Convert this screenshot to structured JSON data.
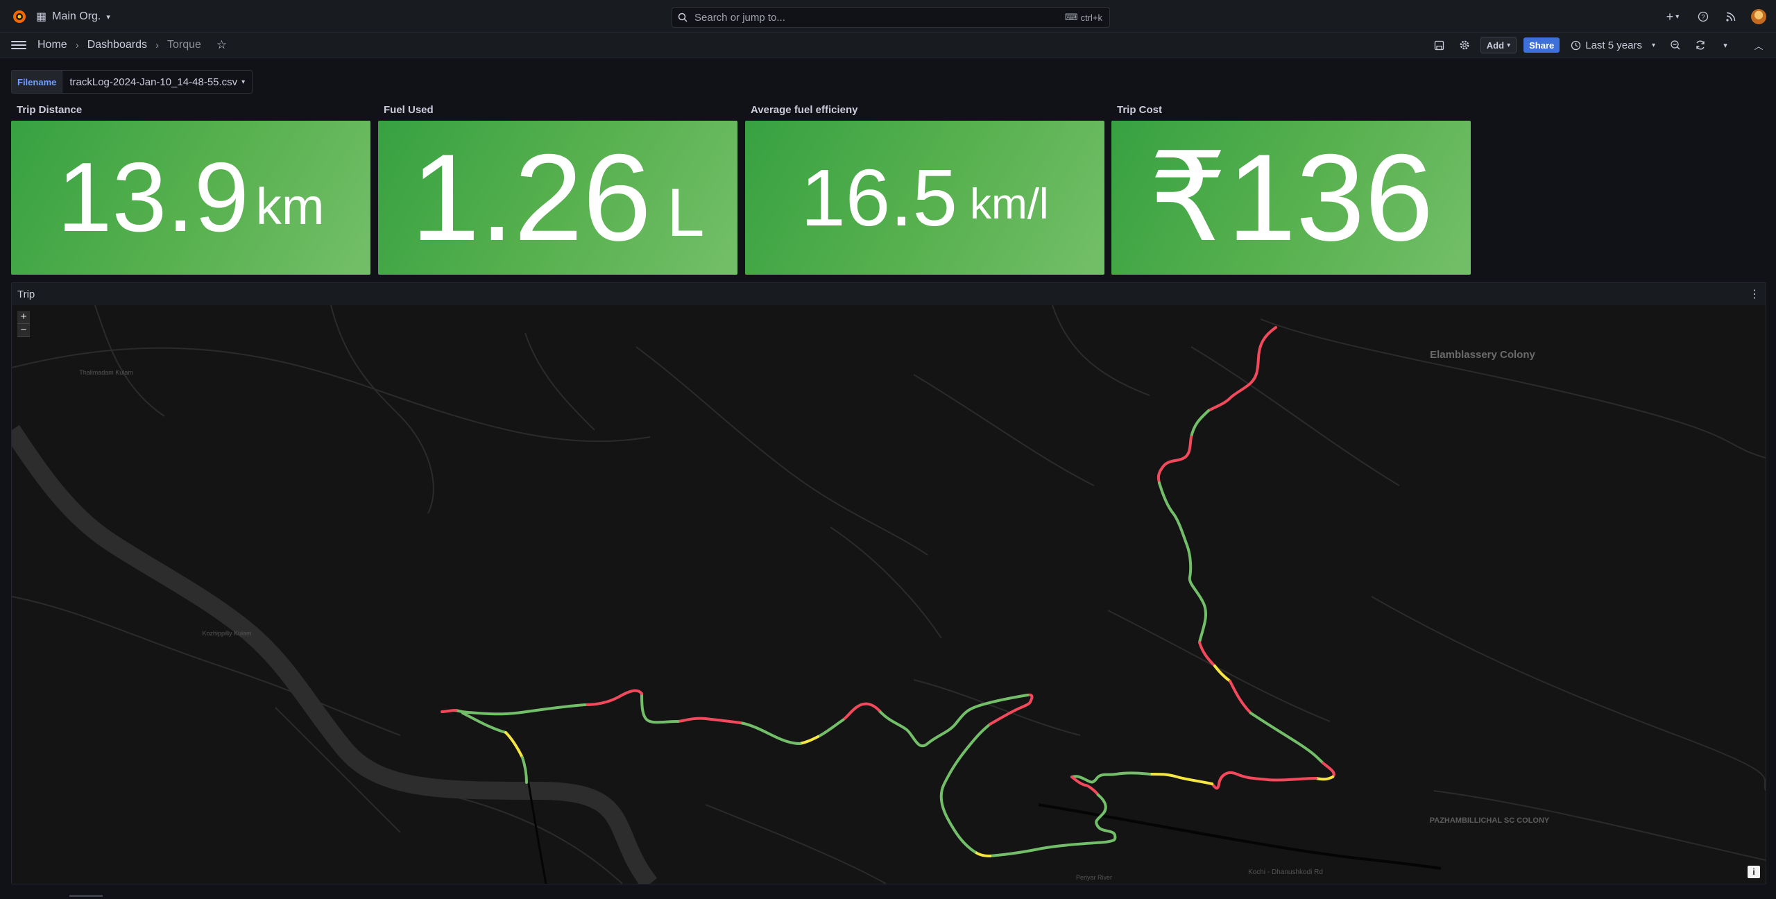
{
  "topbar": {
    "org": "Main Org.",
    "search_placeholder": "Search or jump to...",
    "shortcut": "ctrl+k"
  },
  "breadcrumb": {
    "home": "Home",
    "dashboards": "Dashboards",
    "current": "Torque"
  },
  "toolbar": {
    "add_label": "Add",
    "share_label": "Share",
    "time_range": "Last 5 years"
  },
  "variables": {
    "filename_label": "Filename",
    "filename_value": "trackLog-2024-Jan-10_14-48-55.csv"
  },
  "panels": {
    "trip_distance": {
      "title": "Trip Distance",
      "value": "13.9",
      "unit": "km"
    },
    "fuel_used": {
      "title": "Fuel Used",
      "value": "1.26",
      "unit": "L"
    },
    "avg_efficiency": {
      "title": "Average fuel efficieny",
      "value": "16.5",
      "unit": "km/l"
    },
    "trip_cost": {
      "title": "Trip Cost",
      "value": "₹136",
      "unit": ""
    },
    "trip_map": {
      "title": "Trip"
    }
  },
  "map": {
    "labels": [
      "Elamblassery Colony",
      "PAZHAMBILLICHAL SC COLONY",
      "Thalimadam Kulam",
      "Kozhippilly Kulam",
      "Kochi - Dhanushkodi Rd",
      "Periyar River"
    ],
    "zoom_in": "+",
    "zoom_out": "−",
    "info": "i"
  },
  "colors": {
    "stat_green": "#56b04d",
    "route_green": "#73bf69",
    "route_yellow": "#f5e642",
    "route_red": "#f2495c",
    "accent_blue": "#3d71d9"
  }
}
